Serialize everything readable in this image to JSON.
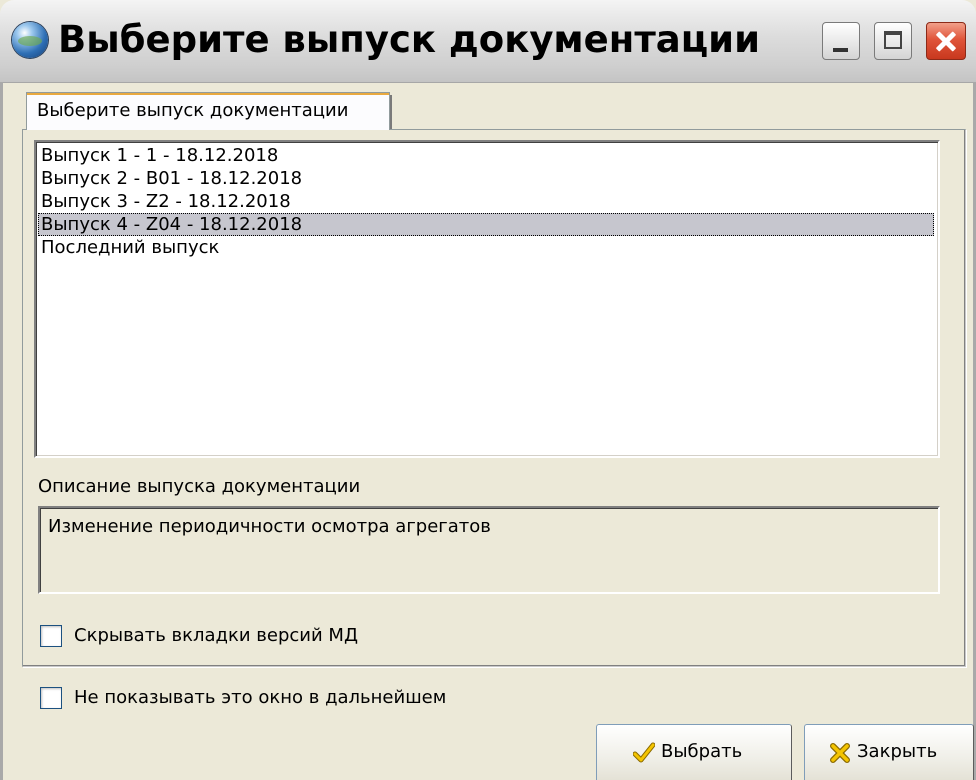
{
  "window": {
    "title": "Выберите выпуск документации",
    "icon": "globe-icon",
    "controls": [
      "minimize-icon",
      "maximize-icon",
      "close-icon"
    ]
  },
  "tab": {
    "label": "Выберите выпуск документации"
  },
  "releases": {
    "items": [
      "Выпуск 1 - 1 - 18.12.2018",
      "Выпуск 2 - B01 - 18.12.2018",
      "Выпуск 3 - Z2 - 18.12.2018",
      "Выпуск 4 - Z04 - 18.12.2018",
      "Последний выпуск"
    ],
    "selected_index": 3
  },
  "description": {
    "label": "Описание выпуска документации",
    "text": "Изменение периодичности осмотра агрегатов"
  },
  "options": {
    "hide_tabs": {
      "label": "Скрывать вкладки версий МД",
      "checked": false
    },
    "dont_show": {
      "label": "Не показывать это окно в дальнейшем",
      "checked": false
    }
  },
  "buttons": {
    "select": {
      "label": "Выбрать",
      "icon": "checkmark-icon"
    },
    "close": {
      "label": "Закрыть",
      "icon": "cross-icon"
    }
  },
  "colors": {
    "dialog_bg": "#ece9d8",
    "selection": "#c6c6ce",
    "close_button": "#e0553a"
  }
}
